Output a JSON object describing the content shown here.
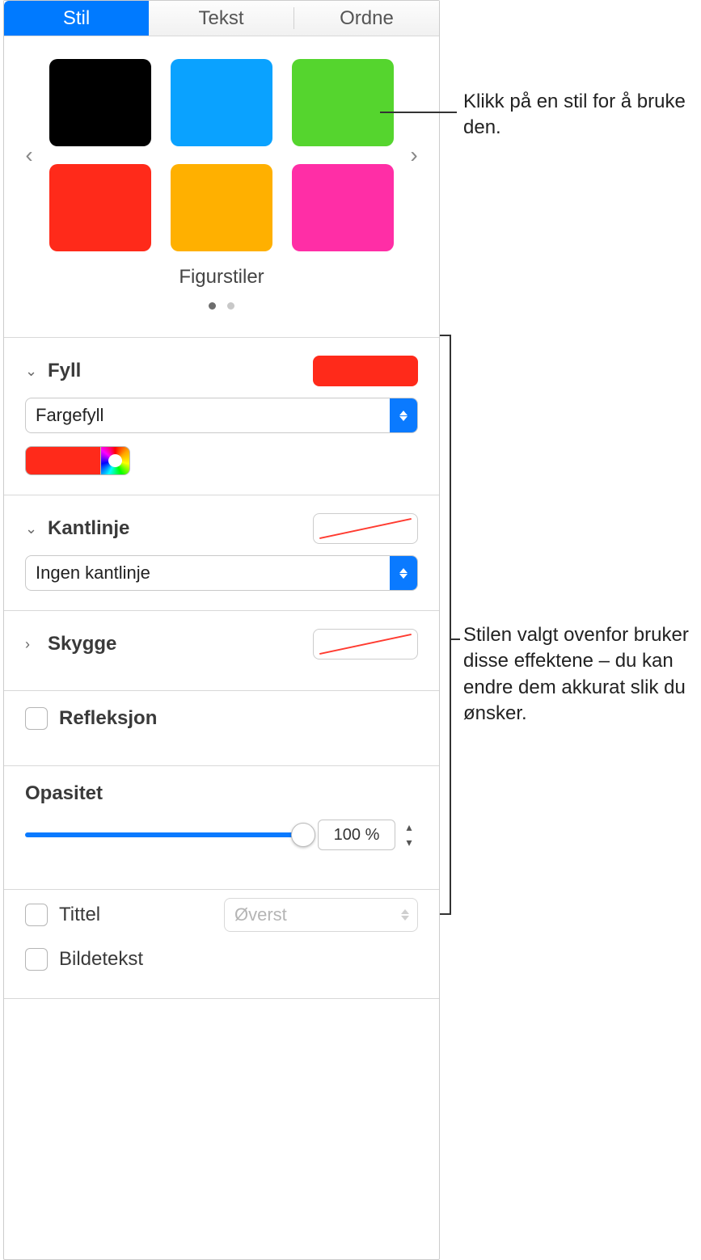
{
  "tabs": {
    "stil": "Stil",
    "tekst": "Tekst",
    "ordne": "Ordne"
  },
  "styles": {
    "label": "Figurstiler",
    "colors": [
      "#000000",
      "#0aa2ff",
      "#55d52e",
      "#ff2a1a",
      "#ffb000",
      "#ff2ea6"
    ]
  },
  "fill": {
    "title": "Fyll",
    "popup": "Fargefyll"
  },
  "stroke": {
    "title": "Kantlinje",
    "popup": "Ingen kantlinje"
  },
  "shadow": {
    "title": "Skygge"
  },
  "reflection": {
    "title": "Refleksjon"
  },
  "opacity": {
    "title": "Opasitet",
    "value": "100 %"
  },
  "titleRow": {
    "label": "Tittel",
    "position": "Øverst"
  },
  "caption": {
    "label": "Bildetekst"
  },
  "callouts": {
    "styles": "Klikk på en stil for å bruke den.",
    "effects": "Stilen valgt ovenfor bruker disse effektene – du kan endre dem akkurat slik du ønsker."
  }
}
